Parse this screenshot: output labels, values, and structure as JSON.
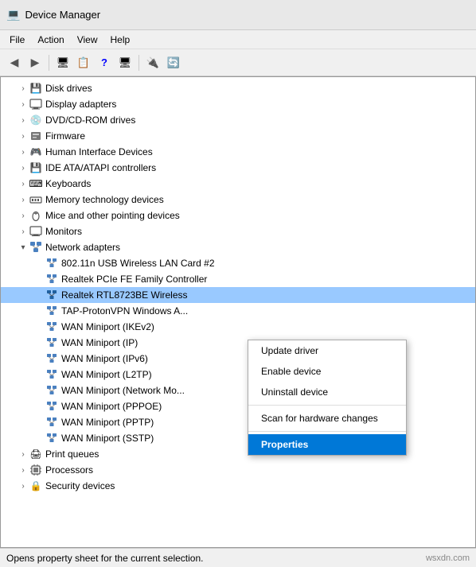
{
  "titleBar": {
    "title": "Device Manager",
    "icon": "computer-icon"
  },
  "menuBar": {
    "items": [
      "File",
      "Action",
      "View",
      "Help"
    ]
  },
  "toolbar": {
    "buttons": [
      "back",
      "forward",
      "up",
      "computer",
      "properties",
      "help",
      "screen",
      "uninstall",
      "scan"
    ]
  },
  "treeItems": [
    {
      "id": "disk",
      "label": "Disk drives",
      "indent": 1,
      "arrow": "collapsed",
      "icon": "disk"
    },
    {
      "id": "display",
      "label": "Display adapters",
      "indent": 1,
      "arrow": "collapsed",
      "icon": "display"
    },
    {
      "id": "dvd",
      "label": "DVD/CD-ROM drives",
      "indent": 1,
      "arrow": "collapsed",
      "icon": "dvd"
    },
    {
      "id": "firmware",
      "label": "Firmware",
      "indent": 1,
      "arrow": "collapsed",
      "icon": "firmware"
    },
    {
      "id": "hid",
      "label": "Human Interface Devices",
      "indent": 1,
      "arrow": "collapsed",
      "icon": "hid"
    },
    {
      "id": "ide",
      "label": "IDE ATA/ATAPI controllers",
      "indent": 1,
      "arrow": "collapsed",
      "icon": "ide"
    },
    {
      "id": "keyboard",
      "label": "Keyboards",
      "indent": 1,
      "arrow": "collapsed",
      "icon": "keyboard"
    },
    {
      "id": "memory",
      "label": "Memory technology devices",
      "indent": 1,
      "arrow": "collapsed",
      "icon": "memory"
    },
    {
      "id": "mice",
      "label": "Mice and other pointing devices",
      "indent": 1,
      "arrow": "collapsed",
      "icon": "mouse"
    },
    {
      "id": "monitors",
      "label": "Monitors",
      "indent": 1,
      "arrow": "collapsed",
      "icon": "monitor"
    },
    {
      "id": "network",
      "label": "Network adapters",
      "indent": 1,
      "arrow": "expanded",
      "icon": "network"
    },
    {
      "id": "wlan",
      "label": "802.11n USB Wireless LAN Card #2",
      "indent": 2,
      "arrow": "none",
      "icon": "network-device"
    },
    {
      "id": "realtek-fe",
      "label": "Realtek PCIe FE Family Controller",
      "indent": 2,
      "arrow": "none",
      "icon": "network-device"
    },
    {
      "id": "realtek-rtl",
      "label": "Realtek RTL8723BE Wireless",
      "indent": 2,
      "arrow": "none",
      "icon": "network-device-selected",
      "selected": true
    },
    {
      "id": "tap",
      "label": "TAP-ProtonVPN Windows A...",
      "indent": 2,
      "arrow": "none",
      "icon": "network-device"
    },
    {
      "id": "wan-ikev2",
      "label": "WAN Miniport (IKEv2)",
      "indent": 2,
      "arrow": "none",
      "icon": "network-device"
    },
    {
      "id": "wan-ip",
      "label": "WAN Miniport (IP)",
      "indent": 2,
      "arrow": "none",
      "icon": "network-device"
    },
    {
      "id": "wan-ipv6",
      "label": "WAN Miniport (IPv6)",
      "indent": 2,
      "arrow": "none",
      "icon": "network-device"
    },
    {
      "id": "wan-l2tp",
      "label": "WAN Miniport (L2TP)",
      "indent": 2,
      "arrow": "none",
      "icon": "network-device"
    },
    {
      "id": "wan-network",
      "label": "WAN Miniport (Network Mo...",
      "indent": 2,
      "arrow": "none",
      "icon": "network-device"
    },
    {
      "id": "wan-pppoe",
      "label": "WAN Miniport (PPPOE)",
      "indent": 2,
      "arrow": "none",
      "icon": "network-device"
    },
    {
      "id": "wan-pptp",
      "label": "WAN Miniport (PPTP)",
      "indent": 2,
      "arrow": "none",
      "icon": "network-device"
    },
    {
      "id": "wan-sstp",
      "label": "WAN Miniport (SSTP)",
      "indent": 2,
      "arrow": "none",
      "icon": "network-device"
    },
    {
      "id": "print",
      "label": "Print queues",
      "indent": 1,
      "arrow": "collapsed",
      "icon": "print"
    },
    {
      "id": "processors",
      "label": "Processors",
      "indent": 1,
      "arrow": "collapsed",
      "icon": "cpu"
    },
    {
      "id": "security",
      "label": "Security devices",
      "indent": 1,
      "arrow": "collapsed",
      "icon": "security"
    }
  ],
  "contextMenu": {
    "items": [
      {
        "id": "update",
        "label": "Update driver",
        "bold": false,
        "separator_after": false
      },
      {
        "id": "enable",
        "label": "Enable device",
        "bold": false,
        "separator_after": false
      },
      {
        "id": "uninstall",
        "label": "Uninstall device",
        "bold": false,
        "separator_after": true
      },
      {
        "id": "scan",
        "label": "Scan for hardware changes",
        "bold": false,
        "separator_after": true
      },
      {
        "id": "properties",
        "label": "Properties",
        "bold": true,
        "separator_after": false
      }
    ]
  },
  "statusBar": {
    "text": "Opens property sheet for the current selection.",
    "brand": "wsxdn.com"
  }
}
